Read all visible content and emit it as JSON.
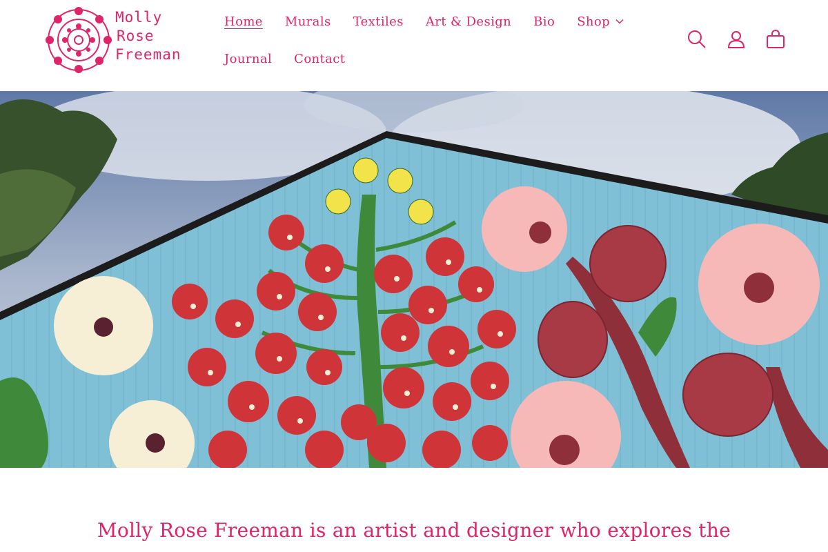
{
  "brand": {
    "logo_lines": [
      "Molly",
      "Rose",
      "Freeman"
    ],
    "logo_icon": "flower-mandala-icon"
  },
  "nav": {
    "items": [
      {
        "label": "Home",
        "active": true
      },
      {
        "label": "Murals"
      },
      {
        "label": "Textiles"
      },
      {
        "label": "Art & Design"
      },
      {
        "label": "Bio"
      },
      {
        "label": "Shop",
        "has_dropdown": true
      },
      {
        "label": "Journal"
      },
      {
        "label": "Contact"
      }
    ]
  },
  "header_icons": [
    "search-icon",
    "account-icon",
    "cart-icon"
  ],
  "hero": {
    "image": "barn mural with tomatoes, flowers and tulips against blue sky"
  },
  "intro": {
    "text": "Molly Rose Freeman is an artist and designer who explores the"
  },
  "colors": {
    "accent": "#e0246a",
    "mural_blue": "#7fc0d6",
    "tomato_red": "#cf3438",
    "leaf_green": "#3f8a3a",
    "pink": "#f7b9b8",
    "maroon": "#8e2f3a"
  }
}
